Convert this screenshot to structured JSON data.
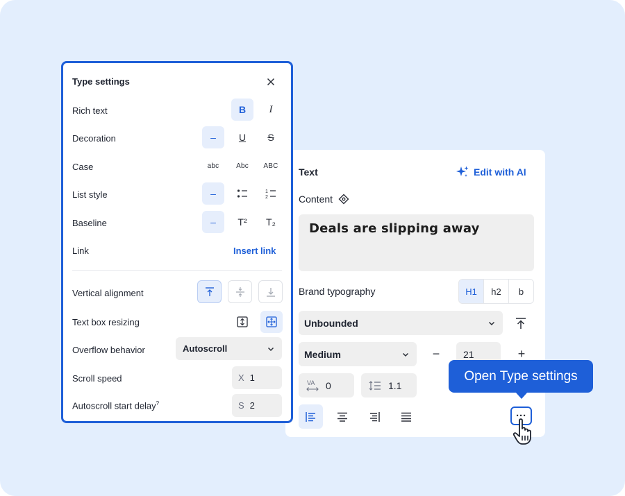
{
  "colors": {
    "accent": "#1e5fd8",
    "background": "#e3eefd",
    "field": "#efefef",
    "active": "#e6eefc"
  },
  "text_panel": {
    "title": "Text",
    "ai_button": {
      "label": "Edit with AI",
      "icon": "sparkle-icon"
    },
    "content_label": "Content",
    "content_icon": "diamond-link-icon",
    "content_value": "Deals are slipping away",
    "brand_typography": {
      "label": "Brand typography",
      "options": [
        "H1",
        "h2",
        "b"
      ],
      "selected": "H1"
    },
    "resize_select": {
      "value": "Unbounded"
    },
    "weight_select": {
      "value": "Medium"
    },
    "font_size": {
      "minus": "−",
      "value": "21",
      "plus": "+"
    },
    "letter_spacing": {
      "icon_label": "VA",
      "value": "0"
    },
    "line_height": {
      "value": "1.1"
    },
    "more_button": "···"
  },
  "tooltip": {
    "label": "Open Type settings"
  },
  "type_settings": {
    "title": "Type settings",
    "rows": {
      "rich_text": "Rich text",
      "decoration": "Decoration",
      "case": "Case",
      "list_style": "List style",
      "baseline": "Baseline",
      "link": "Link",
      "vertical_alignment": "Vertical alignment",
      "text_box_resizing": "Text box resizing",
      "overflow_behavior": "Overflow behavior",
      "scroll_speed": "Scroll speed",
      "autoscroll_delay": "Autoscroll start delay"
    },
    "rich_text_buttons": {
      "bold": "B",
      "italic": "I"
    },
    "decoration_buttons": {
      "none": "–",
      "underline": "U",
      "strike": "S"
    },
    "case_buttons": {
      "lower": "abc",
      "title": "Abc",
      "upper": "ABC"
    },
    "list_buttons": {
      "none": "–"
    },
    "baseline_buttons": {
      "none": "–",
      "super": "T²",
      "sub": "T₂"
    },
    "insert_link": "Insert link",
    "overflow_value": "Autoscroll",
    "scroll_speed": {
      "prefix": "X",
      "value": "1"
    },
    "autoscroll_delay": {
      "prefix": "S",
      "value": "2",
      "superscript": "?"
    }
  }
}
